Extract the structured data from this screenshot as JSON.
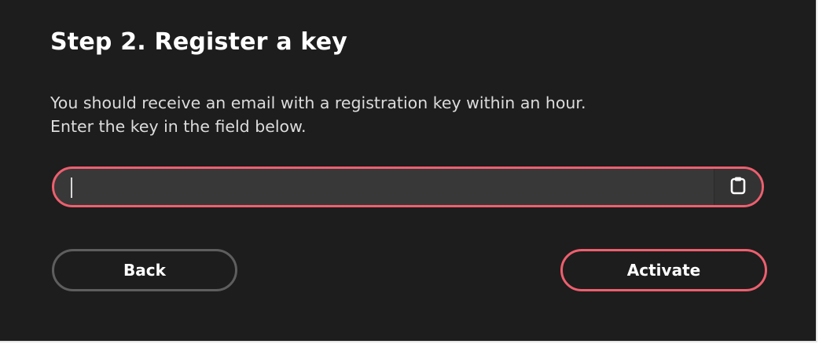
{
  "dialog": {
    "title": "Step 2. Register a key",
    "description_lines": [
      "You should receive an email with a registration key within an hour.",
      "Enter the key in the field below."
    ],
    "key_field": {
      "value": "",
      "placeholder": "",
      "paste_icon": "clipboard-icon"
    },
    "buttons": {
      "back_label": "Back",
      "activate_label": "Activate"
    }
  },
  "colors": {
    "background": "#1d1d1d",
    "accent": "#ee5f6e",
    "field_background": "#383838",
    "secondary_border": "#5e5e5e",
    "text": "#ffffff"
  }
}
